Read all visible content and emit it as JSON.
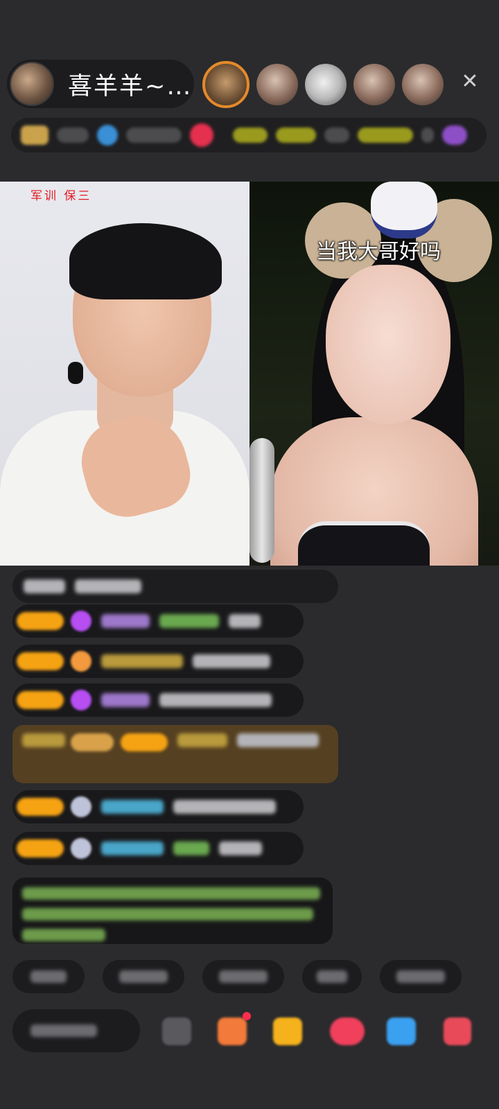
{
  "header": {
    "host_name": "喜羊羊~…",
    "close_label": "✕"
  },
  "video": {
    "left_caption": "军训  保三",
    "right_sticker_text": "当我大哥好吗"
  },
  "colors": {
    "background": "#2b2b2d",
    "pill": "#1c1c1e",
    "badge": "#f5a313",
    "caption_red": "#e21c23",
    "gift_notice": "#60461e"
  }
}
